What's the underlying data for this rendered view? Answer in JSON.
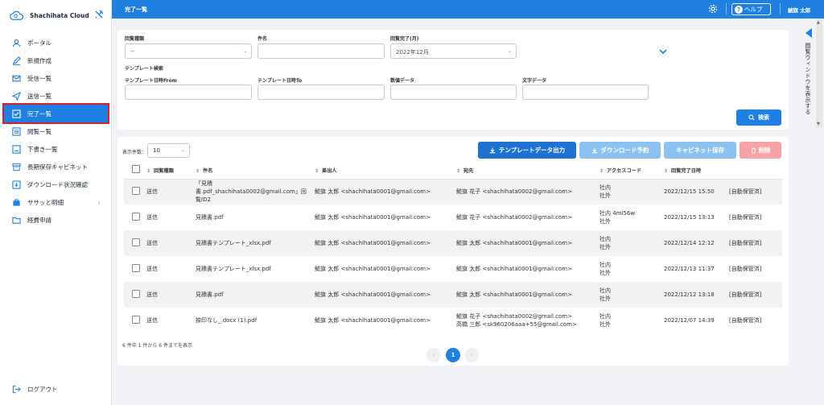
{
  "app": {
    "brand": "Shachihata Cloud"
  },
  "sidebar": {
    "items": [
      {
        "label": "ポータル",
        "icon": "person-icon"
      },
      {
        "label": "新規作成",
        "icon": "pen-icon"
      },
      {
        "label": "受信一覧",
        "icon": "envelope-icon"
      },
      {
        "label": "送信一覧",
        "icon": "send-icon"
      },
      {
        "label": "完了一覧",
        "icon": "check-box-icon",
        "active": true
      },
      {
        "label": "閲覧一覧",
        "icon": "list-icon"
      },
      {
        "label": "下書き一覧",
        "icon": "draft-icon"
      },
      {
        "label": "長期保存キャビネット",
        "icon": "archive-icon"
      },
      {
        "label": "ダウンロード状況確認",
        "icon": "download-icon"
      },
      {
        "label": "ササッと明細",
        "icon": "bag-icon",
        "has_children": true
      },
      {
        "label": "経費申請",
        "icon": "folder-icon"
      }
    ],
    "logout": "ログアウト"
  },
  "header": {
    "title": "完了一覧",
    "help": "ヘルプ",
    "user": "鯱旗 太郎"
  },
  "right_panel": {
    "label": "閲覧ウィンドウを表示する"
  },
  "search": {
    "circ_type_label": "回覧種類",
    "circ_type_value": "--",
    "subject_label": "件名",
    "subject_value": "",
    "completed_month_label": "回覧完了(月)",
    "completed_month_value": "2022年12月",
    "template_section": "テンプレート検索",
    "date_from_label": "テンプレート日時From",
    "date_to_label": "テンプレート日時To",
    "number_label": "数値データ",
    "text_label": "文字データ",
    "search_button": "検索"
  },
  "results": {
    "page_size_label": "表示件数：",
    "page_size": "10",
    "buttons": {
      "template_export": "テンプレートデータ出力",
      "download_reserve": "ダウンロード予約",
      "cabinet_save": "キャビネット保存",
      "delete": "削除"
    },
    "columns": [
      "回覧種類",
      "件名",
      "差出人",
      "宛先",
      "アクセスコード",
      "回覧完了日時",
      ""
    ],
    "rows": [
      {
        "type": "送信",
        "subject": "「見積書.pdf_shachihata0002@gmail.com」回覧ID2",
        "sender": "鯱旗 太郎 <shachihata0001@gmail.com>",
        "to": "鯱旗 花子 <shachihata0002@gmail.com>",
        "access": "社内\n社外",
        "date": "2022/12/15 15:50",
        "status": "[自動保管済]"
      },
      {
        "type": "送信",
        "subject": "見積書.pdf",
        "sender": "鯱旗 太郎 <shachihata0001@gmail.com>",
        "to": "鯱旗 花子 <shachihata0002@gmail.com>",
        "access": "社内 4mi56w\n社外",
        "date": "2022/12/15 13:13",
        "status": "[自動保管済]"
      },
      {
        "type": "送信",
        "subject": "見積書テンプレート_xlsx.pdf",
        "sender": "鯱旗 太郎 <shachihata0001@gmail.com>",
        "to": "鯱旗 太郎 <shachihata0001@gmail.com>",
        "access": "社内\n社外",
        "date": "2022/12/14 12:12",
        "status": "[自動保管済]"
      },
      {
        "type": "送信",
        "subject": "見積書テンプレート_xlsx.pdf",
        "sender": "鯱旗 太郎 <shachihata0001@gmail.com>",
        "to": "鯱旗 太郎 <shachihata0001@gmail.com>",
        "access": "社内\n社外",
        "date": "2022/12/13 11:37",
        "status": "[自動保管済]"
      },
      {
        "type": "送信",
        "subject": "見積書.pdf",
        "sender": "鯱旗 太郎 <shachihata0001@gmail.com>",
        "to": "鯱旗 太郎 <shachihata0001@gmail.com>",
        "access": "社内\n社外",
        "date": "2022/12/12 13:18",
        "status": "[自動保管済]"
      },
      {
        "type": "送信",
        "subject": "捺印なし_.docx (1).pdf",
        "sender": "鯱旗 太郎 <shachihata0001@gmail.com>",
        "to": "鯱旗 花子 <shachihata0002@gmail.com>\n高橋 三郎 <sk960206aaa+55@gmail.com>",
        "access": "社内\n社外",
        "date": "2022/12/07 14:39",
        "status": "[自動保管済]"
      }
    ],
    "footer": "6 件中 1 件から 6 件までを表示",
    "pagination": {
      "prev": "‹",
      "current": "1",
      "next": "›"
    }
  },
  "colors": {
    "primary": "#1f80e2",
    "active_outline": "#d7202b"
  }
}
